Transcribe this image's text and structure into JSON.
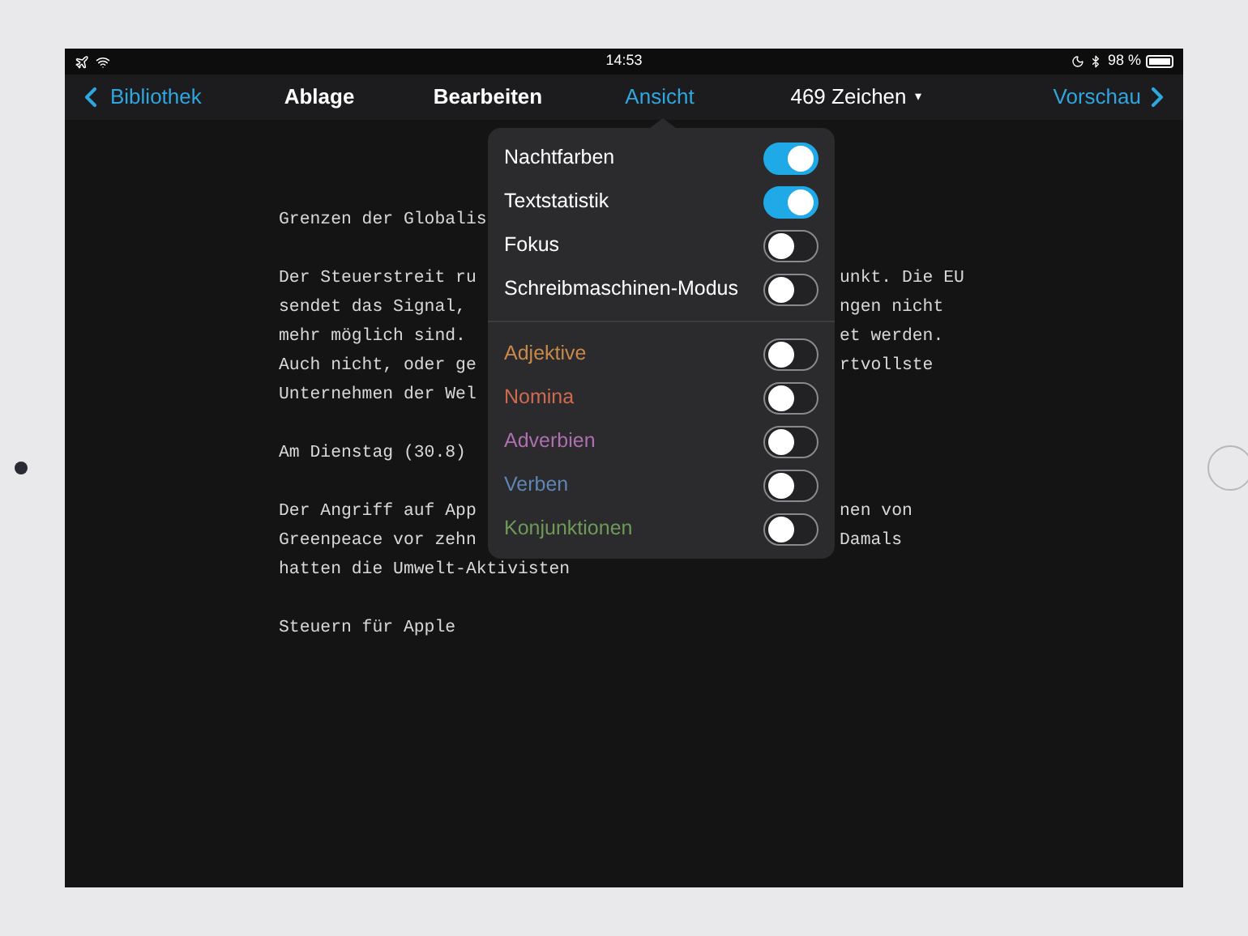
{
  "status_bar": {
    "time": "14:53",
    "battery": "98 %"
  },
  "nav": {
    "back": "Bibliothek",
    "menus": [
      {
        "label": "Ablage",
        "selected": false
      },
      {
        "label": "Bearbeiten",
        "selected": false
      },
      {
        "label": "Ansicht",
        "selected": true
      }
    ],
    "count": {
      "label": "469 Zeichen",
      "caret": "▾"
    },
    "forward": "Vorschau"
  },
  "popover": {
    "options": [
      {
        "label": "Nachtfarben",
        "on": true
      },
      {
        "label": "Textstatistik",
        "on": true
      },
      {
        "label": "Fokus",
        "on": false
      },
      {
        "label": "Schreibmaschinen-Modus",
        "on": false
      }
    ],
    "highlights": [
      {
        "label": "Adjektive",
        "on": false,
        "color": "#c9894a"
      },
      {
        "label": "Nomina",
        "on": false,
        "color": "#d06a50"
      },
      {
        "label": "Adverbien",
        "on": false,
        "color": "#b06fb0"
      },
      {
        "label": "Verben",
        "on": false,
        "color": "#5f86b5"
      },
      {
        "label": "Konjunktionen",
        "on": false,
        "color": "#6f9a5a"
      }
    ]
  },
  "document": {
    "paragraphs": [
      [
        {
          "left": "Grenzen der Globalis"
        }
      ],
      [
        {
          "left": "Der Steuerstreit ru",
          "right": "unkt. Die EU"
        },
        {
          "left": "sendet das Signal,",
          "right": "ngen nicht"
        },
        {
          "left": "mehr möglich sind.",
          "right": "et werden."
        },
        {
          "left": "Auch nicht, oder ge",
          "right": "rtvollste"
        },
        {
          "left": "Unternehmen der Wel"
        }
      ],
      [
        {
          "left": "Am Dienstag (30.8)"
        }
      ],
      [
        {
          "left": "Der Angriff auf App",
          "right": "nen von"
        },
        {
          "left": "Greenpeace vor zehn",
          "right": "Damals"
        },
        {
          "left": "hatten die Umwelt-Aktivisten"
        }
      ],
      [
        {
          "left": "Steuern für Apple"
        }
      ]
    ]
  }
}
